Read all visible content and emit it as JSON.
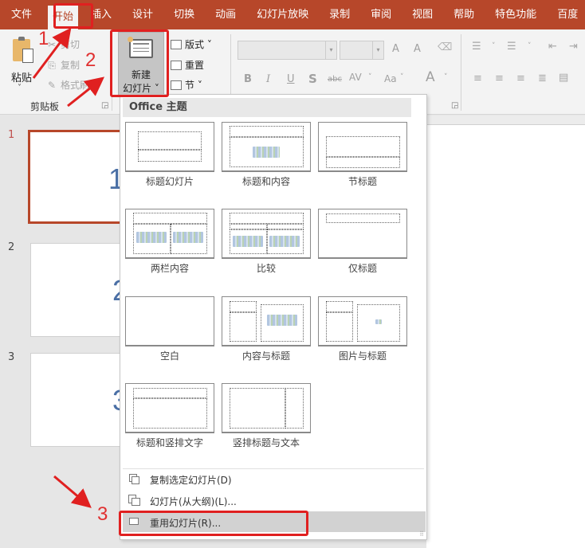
{
  "menubar": {
    "tabs": [
      {
        "label": "文件",
        "active": false
      },
      {
        "label": "开始",
        "active": true
      },
      {
        "label": "插入",
        "active": false
      },
      {
        "label": "设计",
        "active": false
      },
      {
        "label": "切换",
        "active": false
      },
      {
        "label": "动画",
        "active": false
      },
      {
        "label": "幻灯片放映",
        "active": false
      },
      {
        "label": "录制",
        "active": false
      },
      {
        "label": "审阅",
        "active": false
      },
      {
        "label": "视图",
        "active": false
      },
      {
        "label": "帮助",
        "active": false
      },
      {
        "label": "特色功能",
        "active": false
      },
      {
        "label": "百度",
        "active": false
      }
    ]
  },
  "ribbon": {
    "clipboard": {
      "paste_label": "粘贴",
      "cut_label": "剪切",
      "copy_label": "复制",
      "format_painter_label": "格式刷",
      "group_label": "剪贴板"
    },
    "slides": {
      "new_slide_line1": "新建",
      "new_slide_line2": "幻灯片 ˅",
      "layout_label": "版式 ˅",
      "reset_label": "重置",
      "section_label": "节 ˅"
    },
    "font": {
      "font_name": "",
      "font_size": "",
      "grow": "A",
      "shrink": "A",
      "bold": "B",
      "italic": "I",
      "underline": "U",
      "shadow": "S",
      "strike": "abc",
      "spacing": "AV",
      "case": "Aa",
      "color": "A"
    }
  },
  "slide_panel": {
    "slides": [
      {
        "number": "1",
        "content": "1",
        "selected": true
      },
      {
        "number": "2",
        "content": "2",
        "selected": false
      },
      {
        "number": "3",
        "content": "3",
        "selected": false
      }
    ]
  },
  "new_slide_menu": {
    "section_header": "Office 主题",
    "layouts": [
      {
        "name": "标题幻灯片"
      },
      {
        "name": "标题和内容"
      },
      {
        "name": "节标题"
      },
      {
        "name": "两栏内容"
      },
      {
        "name": "比较"
      },
      {
        "name": "仅标题"
      },
      {
        "name": "空白"
      },
      {
        "name": "内容与标题"
      },
      {
        "name": "图片与标题"
      },
      {
        "name": "标题和竖排文字"
      },
      {
        "name": "竖排标题与文本"
      }
    ],
    "commands": [
      {
        "label": "复制选定幻灯片(D)",
        "icon": "duplicate-slide-icon"
      },
      {
        "label": "幻灯片(从大纲)(L)...",
        "icon": "slides-from-outline-icon"
      },
      {
        "label": "重用幻灯片(R)...",
        "icon": "reuse-slides-icon",
        "highlighted": true
      }
    ]
  },
  "annotations": {
    "step1": "1",
    "step2": "2",
    "step3": "3",
    "color": "#e02020"
  },
  "colors": {
    "accent": "#b7472a",
    "selected_slide_border": "#b7472a",
    "slide_number_text": "#4a6fa5"
  }
}
